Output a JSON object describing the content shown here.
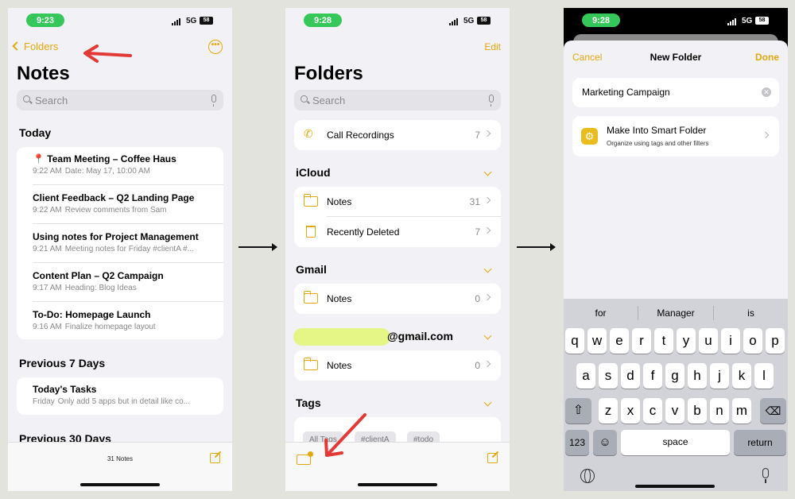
{
  "colors": {
    "accent": "#e3a80b",
    "status_green": "#35c759",
    "annotation_red": "#e23a36"
  },
  "status": {
    "net": "5G",
    "battery": "58",
    "p1_time": "9:23",
    "p2_time": "9:28",
    "p3_time": "9:28"
  },
  "s1": {
    "back_label": "Folders",
    "title": "Notes",
    "search_placeholder": "Search",
    "today_header": "Today",
    "prev7_header": "Previous 7 Days",
    "prev30_header": "Previous 30 Days",
    "today": [
      {
        "title": "Team Meeting – Coffee Haus",
        "time": "9:22 AM",
        "preview": "Date: May 17, 10:00 AM"
      },
      {
        "title": "Client Feedback – Q2 Landing Page",
        "time": "9:22 AM",
        "preview": "Review comments from Sam"
      },
      {
        "title": "Using notes for Project Management",
        "time": "9:21 AM",
        "preview": "Meeting notes for Friday #clientA #..."
      },
      {
        "title": "Content Plan – Q2 Campaign",
        "time": "9:17 AM",
        "preview": "Heading: Blog Ideas"
      },
      {
        "title": "To-Do: Homepage Launch",
        "time": "9:16 AM",
        "preview": "Finalize homepage layout"
      }
    ],
    "prev7": [
      {
        "title": "Today's Tasks",
        "time": "Friday",
        "preview": "Only add 5 apps but in detail like co..."
      }
    ],
    "note_count": "31 Notes"
  },
  "s2": {
    "edit_label": "Edit",
    "title": "Folders",
    "search_placeholder": "Search",
    "call_recordings": {
      "label": "Call Recordings",
      "count": "7"
    },
    "icloud_header": "iCloud",
    "icloud": [
      {
        "label": "Notes",
        "count": "31"
      },
      {
        "label": "Recently Deleted",
        "count": "7"
      }
    ],
    "gmail_header": "Gmail",
    "gmail": [
      {
        "label": "Notes",
        "count": "0"
      }
    ],
    "account_suffix": "@gmail.com",
    "account_notes": {
      "label": "Notes",
      "count": "0"
    },
    "tags_header": "Tags",
    "tags": [
      "All Tags",
      "#clientA",
      "#todo"
    ]
  },
  "s3": {
    "cancel_label": "Cancel",
    "title": "New Folder",
    "done_label": "Done",
    "folder_name": "Marketing Campaign",
    "smart_title": "Make Into Smart Folder",
    "smart_sub": "Organize using tags and other filters",
    "suggestions": [
      "for",
      "Manager",
      "is"
    ],
    "row1": [
      "q",
      "w",
      "e",
      "r",
      "t",
      "y",
      "u",
      "i",
      "o",
      "p"
    ],
    "row2": [
      "a",
      "s",
      "d",
      "f",
      "g",
      "h",
      "j",
      "k",
      "l"
    ],
    "row3": [
      "z",
      "x",
      "c",
      "v",
      "b",
      "n",
      "m"
    ],
    "key_123": "123",
    "key_space": "space",
    "key_return": "return"
  }
}
